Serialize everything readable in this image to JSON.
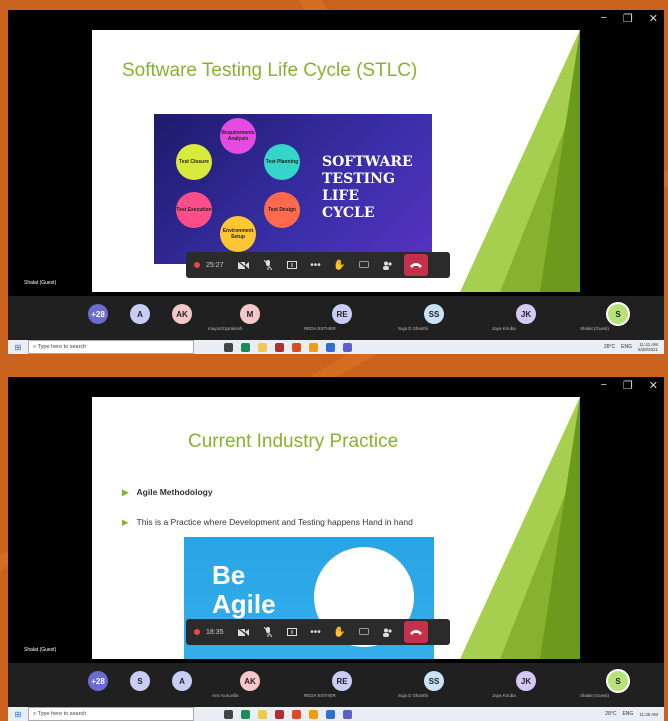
{
  "window_controls": {
    "minimize": "−",
    "maximize": "❐",
    "close": "✕"
  },
  "screen1": {
    "slide_title": "Software Testing Life Cycle (STLC)",
    "diagram_title": [
      "SOFTWARE",
      "TESTING",
      "LIFE",
      "CYCLE"
    ],
    "nodes": [
      "Requirements Analysis",
      "Test Planning",
      "Test Design",
      "Environment Setup",
      "Test Execution",
      "Test Closure"
    ],
    "guest_label": "Shalat (Guest)",
    "timer": "25:27",
    "participants": [
      {
        "initials": "+28",
        "name": ""
      },
      {
        "initials": "A",
        "name": ""
      },
      {
        "initials": "AK",
        "name": ""
      },
      {
        "initials": "M",
        "name": "mayuri21prakash"
      },
      {
        "initials": "RE",
        "name": "REDA ESTHER"
      },
      {
        "initials": "SS",
        "name": "Suja D Shanthi"
      },
      {
        "initials": "JK",
        "name": "Jaya Kiruba"
      },
      {
        "initials": "S",
        "name": "Shalat (Guest)"
      }
    ],
    "search_placeholder": "Type here to search",
    "weather": "28°C",
    "lang": "ENG",
    "time": "11:41 AM",
    "date": "6/30/2021"
  },
  "screen2": {
    "slide_title": "Current Industry Practice",
    "bullet1": "Agile Methodology",
    "bullet2": "This is a Practice where Development and Testing happens Hand in hand",
    "agile_text": [
      "Be",
      "Agile"
    ],
    "guest_label": "Shalat (Guest)",
    "timer": "18:35",
    "participants": [
      {
        "initials": "+28",
        "name": ""
      },
      {
        "initials": "S",
        "name": ""
      },
      {
        "initials": "A",
        "name": ""
      },
      {
        "initials": "AK",
        "name": "Ann Kuruvilla"
      },
      {
        "initials": "RE",
        "name": "REDA ESTHER"
      },
      {
        "initials": "SS",
        "name": "Suja D Shanthi"
      },
      {
        "initials": "JK",
        "name": "Jaya Kiruba"
      },
      {
        "initials": "S",
        "name": "Shalat (Guest)"
      }
    ],
    "search_placeholder": "Type here to search",
    "weather": "28°C",
    "lang": "ENG",
    "time": "11:35 AM"
  },
  "colors": {
    "slide_title": "#86b22f",
    "avatar_colors": [
      "#6c6cd0",
      "#c9cdf5",
      "#f5c7c7",
      "#f5c7c7",
      "#c9cdf5",
      "#c9e2f5",
      "#d3c9f5",
      "#b7e27a"
    ]
  }
}
